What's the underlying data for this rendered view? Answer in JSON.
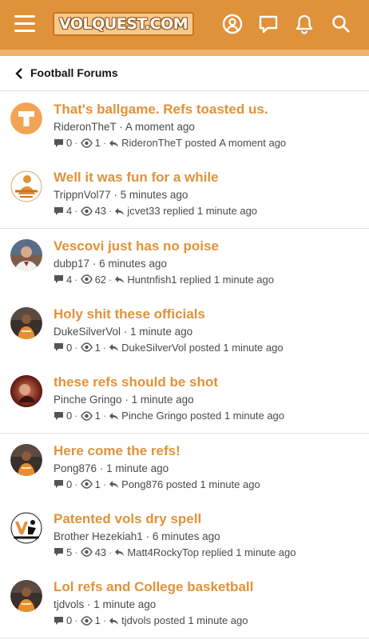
{
  "header": {
    "logo_text": "VOLQUEST.COM",
    "brand_color": "#e0923a",
    "icons": [
      "menu-icon",
      "account-icon",
      "chat-icon",
      "bell-icon",
      "search-icon"
    ]
  },
  "breadcrumb": {
    "label": "Football Forums"
  },
  "threads": [
    {
      "title": "That's ballgame. Refs toasted us.",
      "author": "RideronTheT",
      "started": "A moment ago",
      "replies": "0",
      "views": "1",
      "last_user": "RideronTheT",
      "last_action": "posted",
      "last_time": "A moment ago",
      "avatar": "power-t-logo"
    },
    {
      "title": "Well it was fun for a while",
      "author": "TrippnVol77",
      "started": "5 minutes ago",
      "replies": "4",
      "views": "43",
      "last_user": "jcvet33",
      "last_action": "replied",
      "last_time": "1 minute ago",
      "avatar": "mascot"
    },
    {
      "title": "Vescovi just has no poise",
      "author": "dubp17",
      "started": "6 minutes ago",
      "replies": "4",
      "views": "62",
      "last_user": "Huntnfish1",
      "last_action": "replied",
      "last_time": "1 minute ago",
      "avatar": "person"
    },
    {
      "title": "Holy shit these officials",
      "author": "DukeSilverVol",
      "started": "1 minute ago",
      "replies": "0",
      "views": "1",
      "last_user": "DukeSilverVol",
      "last_action": "posted",
      "last_time": "1 minute ago",
      "avatar": "player"
    },
    {
      "title": "these refs should be shot",
      "author": "Pinche Gringo",
      "started": "1 minute ago",
      "replies": "0",
      "views": "1",
      "last_user": "Pinche Gringo",
      "last_action": "posted",
      "last_time": "1 minute ago",
      "avatar": "photo"
    },
    {
      "title": "Here come the refs!",
      "author": "Pong876",
      "started": "1 minute ago",
      "replies": "0",
      "views": "1",
      "last_user": "Pong876",
      "last_action": "posted",
      "last_time": "1 minute ago",
      "avatar": "player"
    },
    {
      "title": "Patented vols dry spell",
      "author": "Brother Hezekiah1",
      "started": "6 minutes ago",
      "replies": "5",
      "views": "43",
      "last_user": "Matt4RockyTop",
      "last_action": "replied",
      "last_time": "1 minute ago",
      "avatar": "vol-logo"
    },
    {
      "title": "Lol refs and College basketball",
      "author": "tjdvols",
      "started": "1 minute ago",
      "replies": "0",
      "views": "1",
      "last_user": "tjdvols",
      "last_action": "posted",
      "last_time": "1 minute ago",
      "avatar": "player"
    }
  ]
}
